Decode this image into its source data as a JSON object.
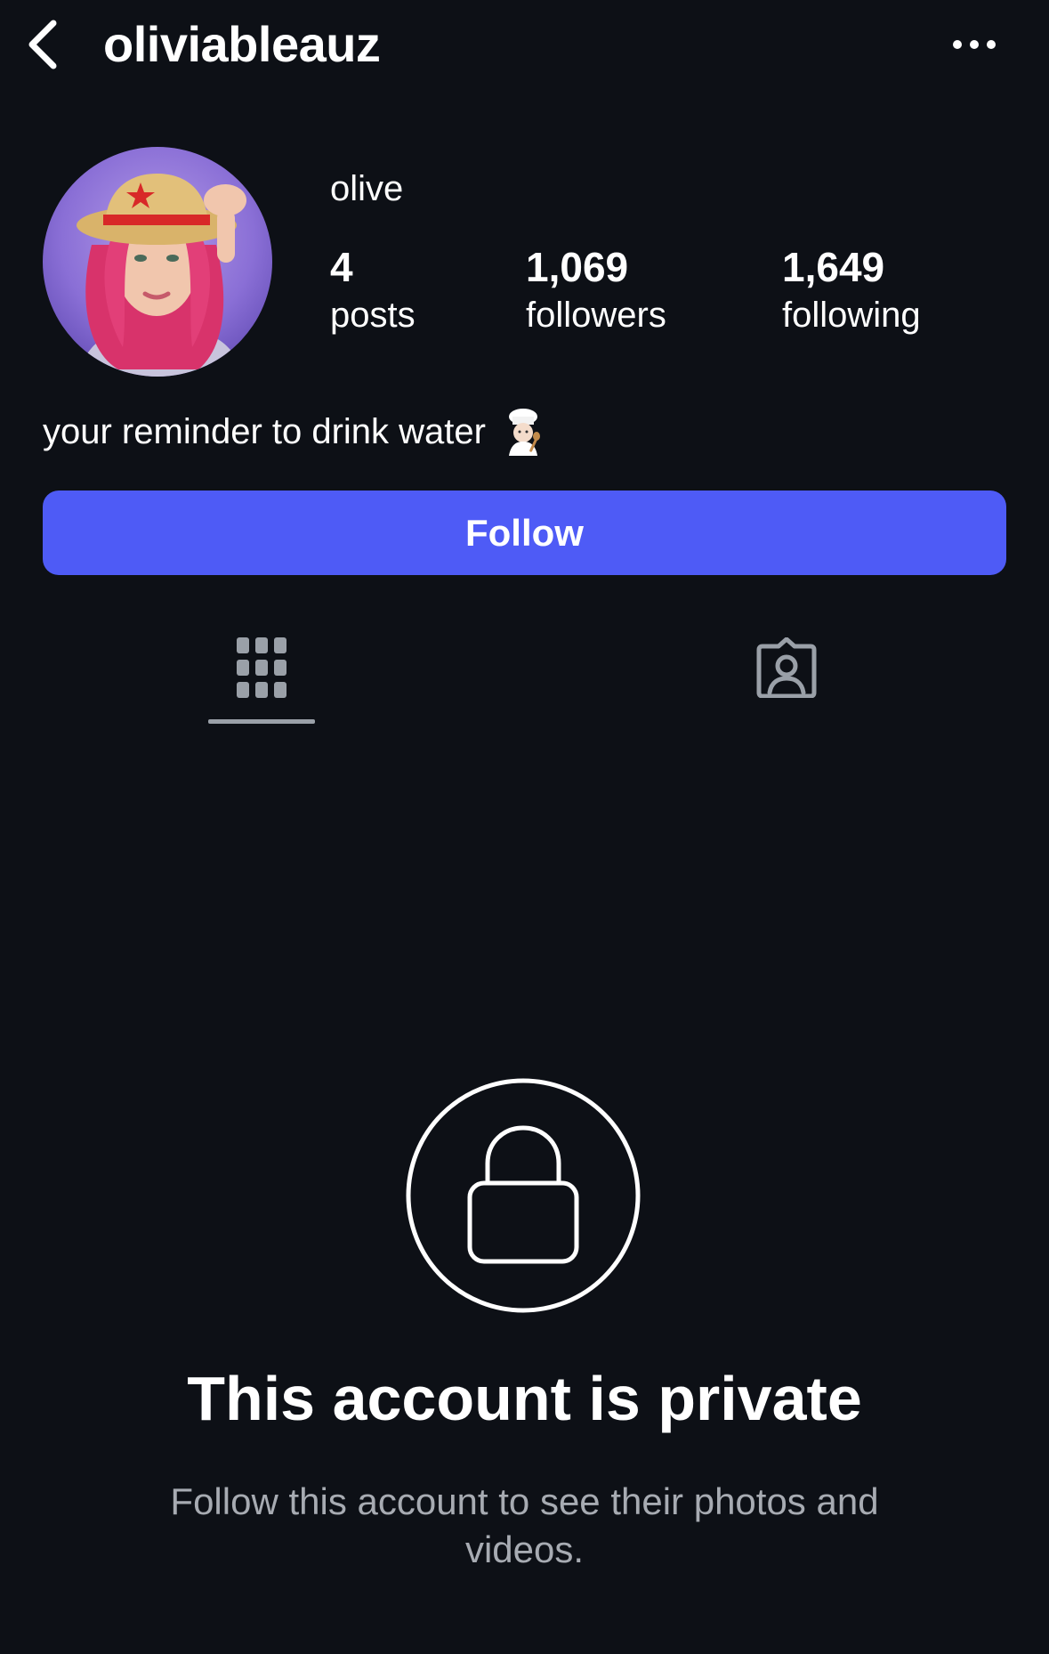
{
  "header": {
    "username": "oliviableauz",
    "back_icon": "chevron-left-icon",
    "more_icon": "ellipsis-horizontal-icon"
  },
  "profile": {
    "display_name": "olive",
    "avatar": "profile-photo",
    "stats": {
      "posts": {
        "count": "4",
        "label": "posts"
      },
      "followers": {
        "count": "1,069",
        "label": "followers"
      },
      "following": {
        "count": "1,649",
        "label": "following"
      }
    },
    "bio": "your reminder to drink water",
    "bio_emoji": "chef-emoji"
  },
  "actions": {
    "follow_label": "Follow"
  },
  "tabs": [
    {
      "name": "posts-grid",
      "icon": "grid-icon",
      "selected": true
    },
    {
      "name": "tagged",
      "icon": "tagged-user-icon",
      "selected": false
    }
  ],
  "private_notice": {
    "icon": "lock-icon",
    "title": "This account is private",
    "subtitle": "Follow this account to see their photos and videos."
  },
  "colors": {
    "background": "#0d1016",
    "follow_button": "#4e5bf6",
    "secondary_text": "#a7abb2"
  }
}
